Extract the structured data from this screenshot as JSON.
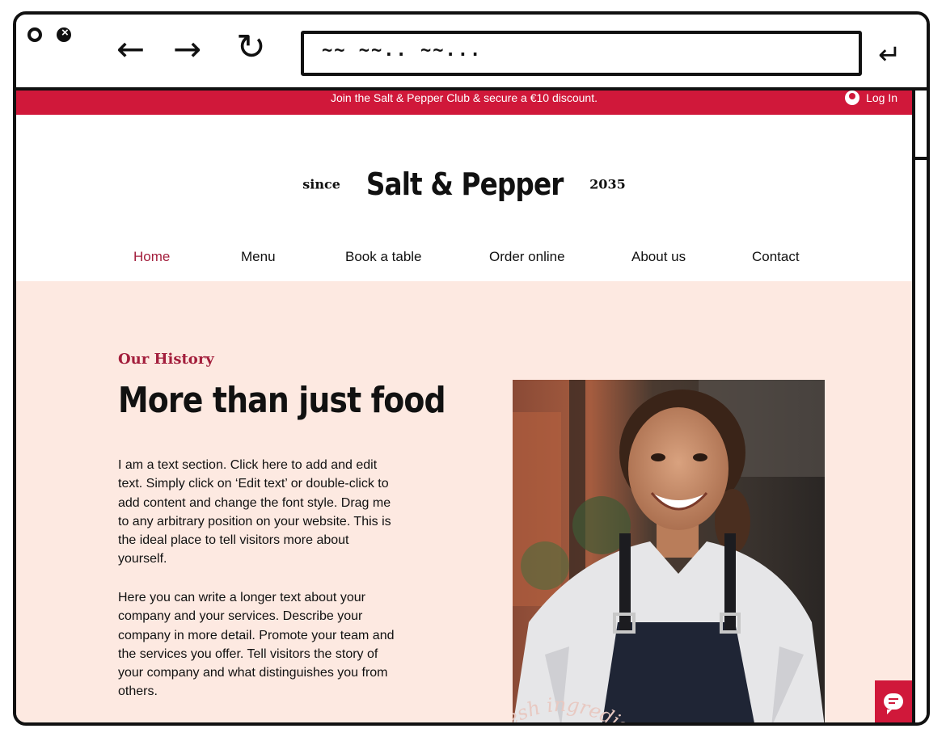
{
  "browser": {
    "address_text": "~~ ~~.. ~~...",
    "back_glyph": "←",
    "forward_glyph": "→",
    "reload_glyph": "↻",
    "enter_glyph": "↵"
  },
  "promo": {
    "text": "Join the Salt & Pepper Club & secure a €10 discount.",
    "login_label": "Log In"
  },
  "logo": {
    "since": "since",
    "brand": "Salt & Pepper",
    "year": "2035"
  },
  "nav": {
    "items": [
      {
        "label": "Home",
        "active": true
      },
      {
        "label": "Menu"
      },
      {
        "label": "Book a table"
      },
      {
        "label": "Order online"
      },
      {
        "label": "About us"
      },
      {
        "label": "Contact"
      }
    ]
  },
  "hero": {
    "eyebrow": "Our History",
    "headline": "More than just food",
    "paragraph1": "I am a text section. Click here to add and edit text. Simply click on ‘Edit text’ or double-click to add content and change the font style. Drag me to any arbitrary position on your website. This is the ideal place to tell visitors more about yourself.",
    "paragraph2": "Here you can write a longer text about your company and your services. Describe your company in more detail. Promote your team and the services you offer. Tell visitors the story of your company and what distinguishes you from others.",
    "photo_caption": "fresh ingredients"
  },
  "colors": {
    "accent": "#d0183a",
    "accent_text": "#a31e3c",
    "hero_background": "#fde9e1"
  },
  "icons": [
    "close-icon",
    "back-arrow-icon",
    "forward-arrow-icon",
    "reload-icon",
    "enter-icon",
    "user-icon",
    "chat-icon"
  ]
}
